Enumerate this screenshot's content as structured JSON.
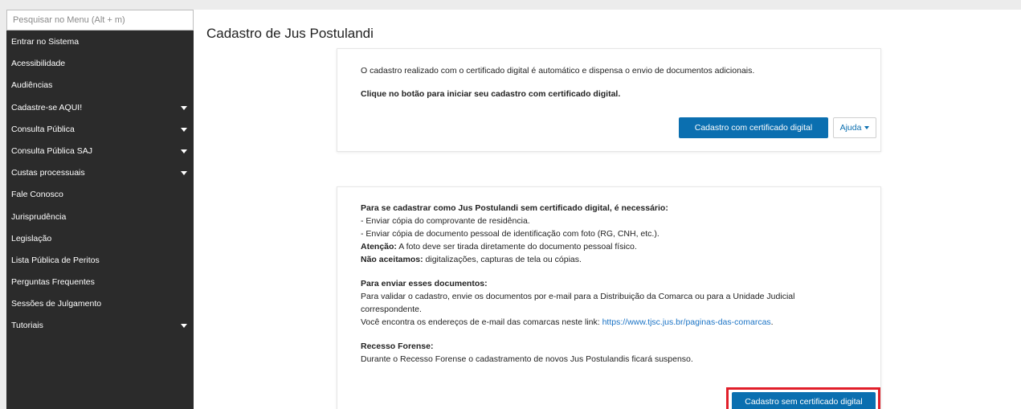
{
  "sidebar": {
    "search_placeholder": "Pesquisar no Menu (Alt + m)",
    "items": [
      {
        "label": "Entrar no Sistema",
        "has_caret": false
      },
      {
        "label": "Acessibilidade",
        "has_caret": false
      },
      {
        "label": "Audiências",
        "has_caret": false
      },
      {
        "label": "Cadastre-se AQUI!",
        "has_caret": true
      },
      {
        "label": "Consulta Pública",
        "has_caret": true
      },
      {
        "label": "Consulta Pública SAJ",
        "has_caret": true
      },
      {
        "label": "Custas processuais",
        "has_caret": true
      },
      {
        "label": "Fale Conosco",
        "has_caret": false
      },
      {
        "label": "Jurisprudência",
        "has_caret": false
      },
      {
        "label": "Legislação",
        "has_caret": false
      },
      {
        "label": "Lista Pública de Peritos",
        "has_caret": false
      },
      {
        "label": "Perguntas Frequentes",
        "has_caret": false
      },
      {
        "label": "Sessões de Julgamento",
        "has_caret": false
      },
      {
        "label": "Tutoriais",
        "has_caret": true
      }
    ]
  },
  "main": {
    "title": "Cadastro de Jus Postulandi",
    "card_cert": {
      "info": "O cadastro realizado com o certificado digital é automático e dispensa o envio de documentos adicionais.",
      "cta": "Clique no botão para iniciar seu cadastro com certificado digital.",
      "button_cert": "Cadastro com certificado digital",
      "button_help": "Ajuda"
    },
    "card_nocert": {
      "heading": "Para se cadastrar como Jus Postulandi sem certificado digital, é necessário:",
      "req1": "- Enviar cópia do comprovante de residência.",
      "req2": "- Enviar cópia de documento pessoal de identificação com foto (RG, CNH, etc.).",
      "attention_label": "Atenção:",
      "attention_text": " A foto deve ser tirada diretamente do documento pessoal físico.",
      "not_accepted_label": "Não aceitamos:",
      "not_accepted_text": " digitalizações, capturas de tela ou cópias.",
      "send_heading": "Para enviar esses documentos:",
      "send_line1": "Para validar o cadastro, envie os documentos por e-mail para a Distribuição da Comarca ou para a Unidade Judicial",
      "send_line2": "correspondente.",
      "send_line3": "Você encontra os endereços de e-mail das comarcas neste link: ",
      "send_link": "https://www.tjsc.jus.br/paginas-das-comarcas",
      "send_after_link": ".",
      "recess_heading": "Recesso Forense:",
      "recess_text": "Durante o Recesso Forense o cadastramento de novos Jus Postulandis ficará suspenso.",
      "button_nocert": "Cadastro sem certificado digital"
    },
    "highlight_color": "#e11f2a",
    "accent_color": "#0b6fb0",
    "sidebar_color": "#2b2b2b"
  }
}
